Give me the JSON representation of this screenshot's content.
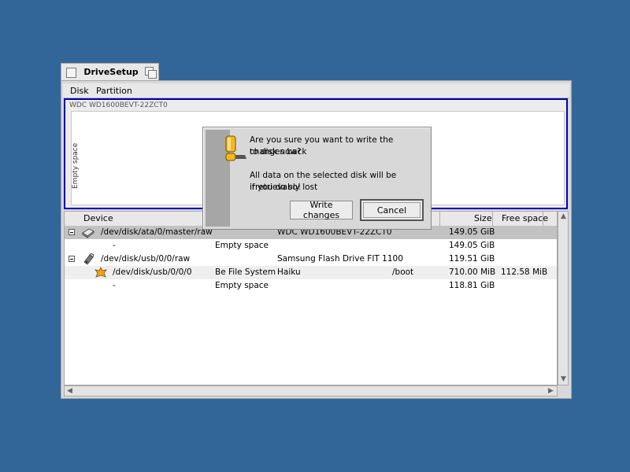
{
  "window": {
    "title": "DriveSetup"
  },
  "menubar": {
    "items": [
      "Disk",
      "Partition"
    ]
  },
  "disk_map": {
    "disk_name": "WDC WD1600BEVT-22ZCT0",
    "partition_label": "Empty space"
  },
  "list": {
    "columns": [
      "Device",
      "Size",
      "Free space"
    ],
    "rows": [
      {
        "device": "/dev/disk/ata/0/master/raw",
        "filesystem": "",
        "volume": "WDC WD1600BEVT-22ZCT0",
        "mounted": "",
        "size": "149.05 GiB",
        "free": ""
      },
      {
        "device": "-",
        "filesystem": "Empty space",
        "volume": "",
        "mounted": "",
        "size": "149.05 GiB",
        "free": ""
      },
      {
        "device": "/dev/disk/usb/0/0/raw",
        "filesystem": "",
        "volume": "Samsung Flash Drive FIT 1100",
        "mounted": "",
        "size": "119.51 GiB",
        "free": ""
      },
      {
        "device": "/dev/disk/usb/0/0/0",
        "filesystem": "Be File System",
        "volume": "Haiku",
        "mounted": "/boot",
        "size": "710.00 MiB",
        "free": "112.58 MiB"
      },
      {
        "device": "-",
        "filesystem": "Empty space",
        "volume": "",
        "mounted": "",
        "size": "118.81 GiB",
        "free": ""
      }
    ]
  },
  "alert": {
    "line1": "Are you sure you want to write the changes back",
    "line2": "to disk now?",
    "line3": "All data on the selected disk will be irretrievably lost",
    "line4": "if you do so!",
    "write_button": "Write changes",
    "cancel_button": "Cancel"
  },
  "icons": {
    "hard_disk": "hard-disk-icon",
    "usb_drive": "usb-drive-icon",
    "haiku": "haiku-leaf-icon",
    "alert": "warning-icon"
  },
  "colors": {
    "desktop": "#336698",
    "selection_border": "#0000b0",
    "alert_stripe": "#a6a6a6"
  }
}
